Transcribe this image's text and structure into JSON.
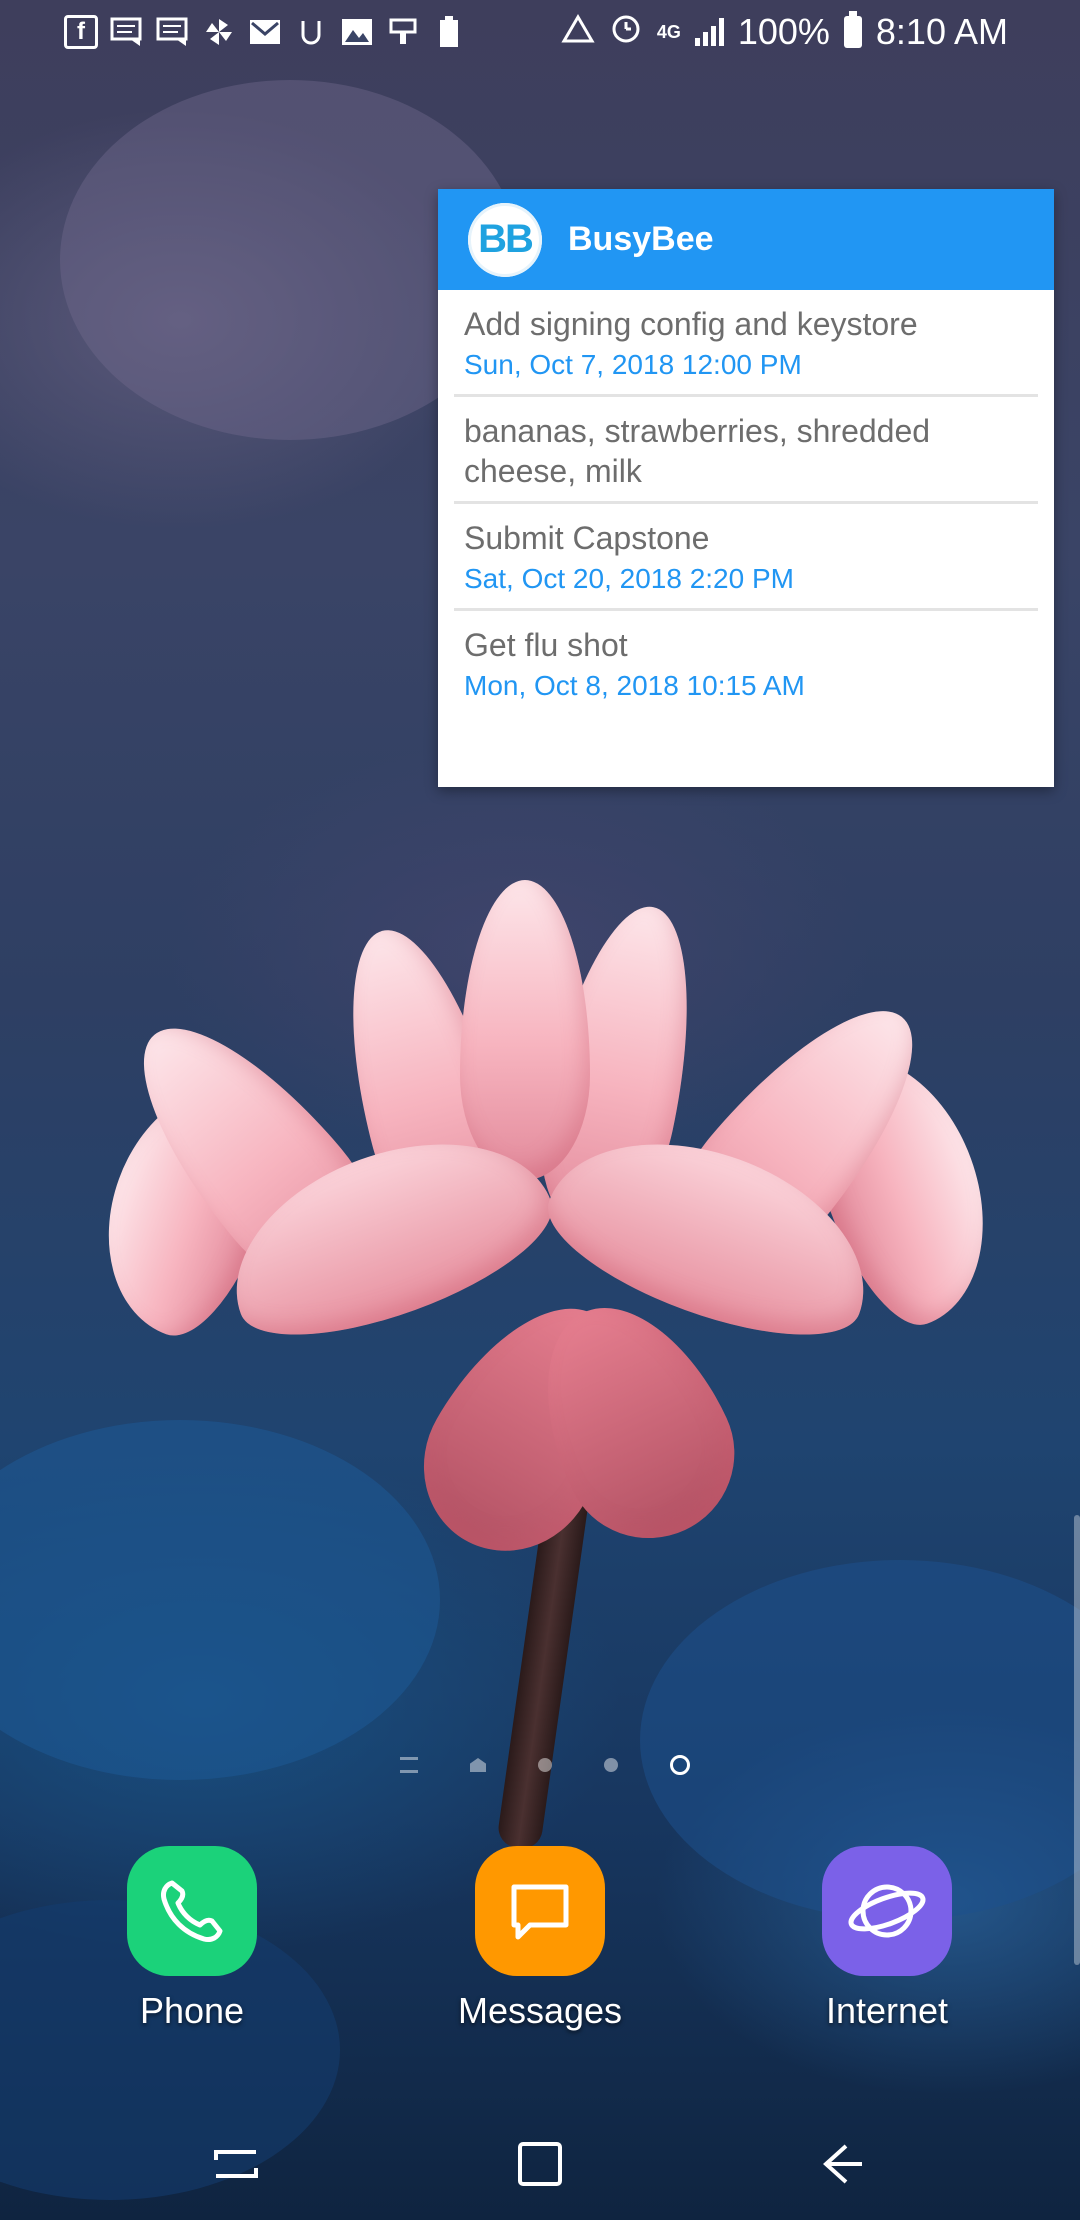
{
  "status_bar": {
    "left_icons": [
      "facebook-icon",
      "messages-icon",
      "messages-icon",
      "pinwheel-icon",
      "gmail-icon",
      "udacity-icon",
      "gallery-icon",
      "clipboard-icon",
      "battery-100-icon"
    ],
    "battery": "100%",
    "time": "8:10 AM",
    "network": "4G LTE"
  },
  "widget": {
    "logo_text": "BB",
    "title": "BusyBee",
    "tasks": [
      {
        "title": "Add signing config and keystore",
        "date": "Sun, Oct 7, 2018  12:00 PM"
      },
      {
        "title": "bananas, strawberries,  shredded cheese,  milk",
        "date": ""
      },
      {
        "title": "Submit Capstone",
        "date": "Sat, Oct 20, 2018  2:20 PM"
      },
      {
        "title": "Get flu shot",
        "date": "Mon, Oct 8, 2018  10:15 AM"
      }
    ],
    "colors": {
      "header": "#2196f3",
      "date": "#2196f3",
      "title": "#6d6d6d"
    }
  },
  "home": {
    "page_count": 5,
    "active_page": 4
  },
  "dock": [
    {
      "label": "Phone",
      "icon": "phone-icon",
      "color": "#1bd27a"
    },
    {
      "label": "Messages",
      "icon": "messages-icon",
      "color": "#ff9800"
    },
    {
      "label": "Internet",
      "icon": "internet-icon",
      "color": "#7b61e8"
    }
  ],
  "nav": {
    "recents": "recents-icon",
    "home": "home-icon",
    "back": "back-icon"
  }
}
